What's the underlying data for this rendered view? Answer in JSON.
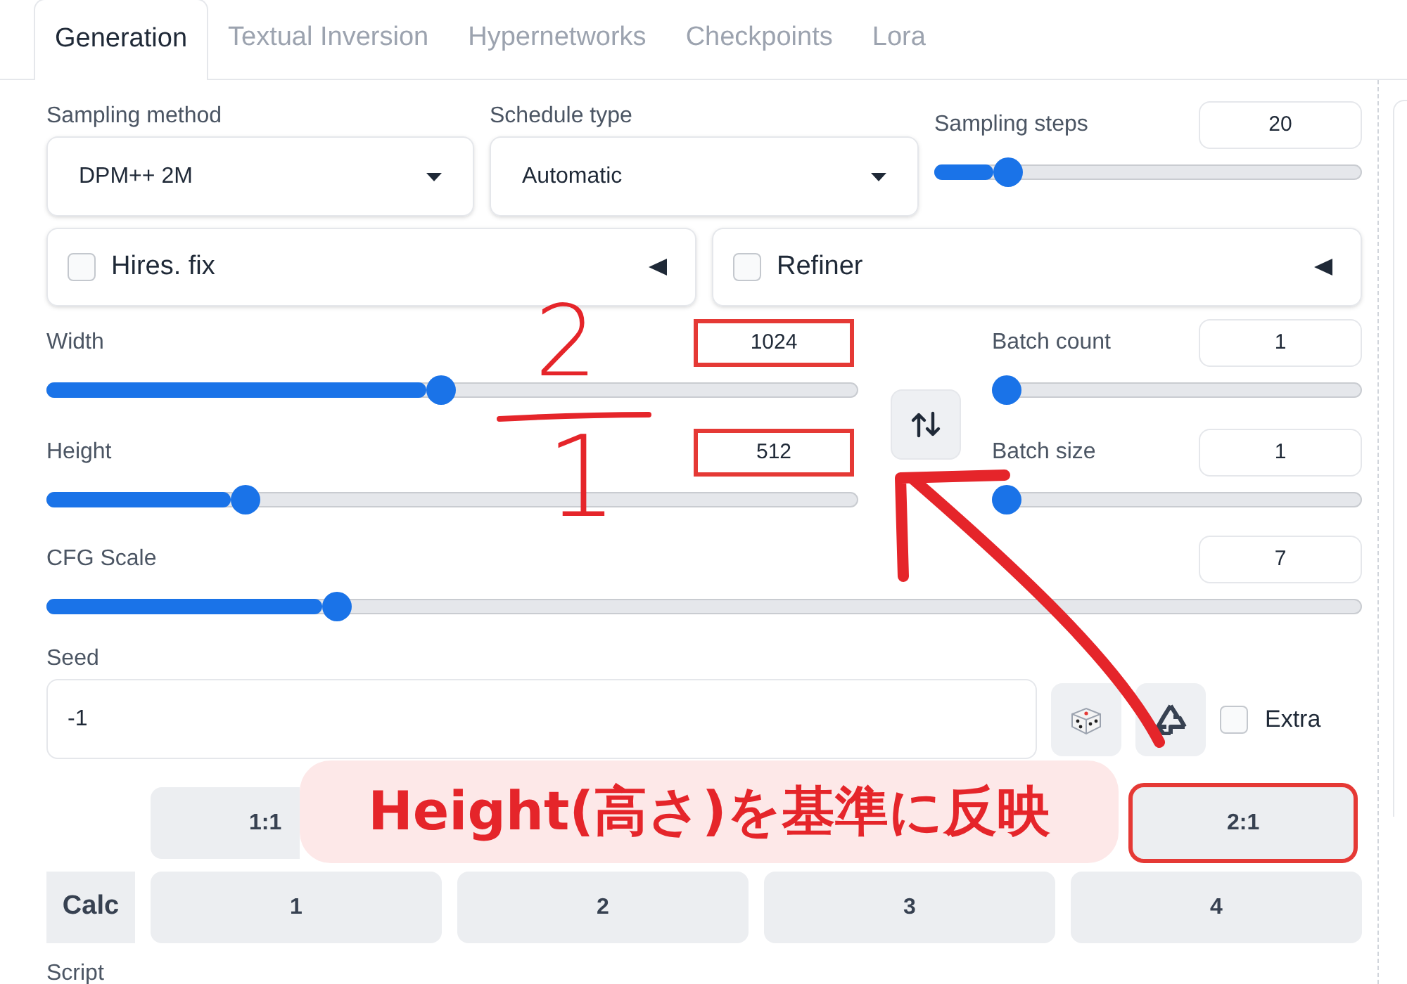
{
  "tabs": [
    {
      "label": "Generation",
      "selected": true
    },
    {
      "label": "Textual Inversion",
      "selected": false
    },
    {
      "label": "Hypernetworks",
      "selected": false
    },
    {
      "label": "Checkpoints",
      "selected": false
    },
    {
      "label": "Lora",
      "selected": false
    }
  ],
  "sampling_method": {
    "label": "Sampling method",
    "value": "DPM++ 2M"
  },
  "schedule_type": {
    "label": "Schedule type",
    "value": "Automatic"
  },
  "sampling_steps": {
    "label": "Sampling steps",
    "value": "20",
    "level": 0.15,
    "highlighted": false
  },
  "accordions": [
    {
      "label": "Hires. fix",
      "checked": false
    },
    {
      "label": "Refiner",
      "checked": false
    }
  ],
  "width": {
    "label": "Width",
    "value": "1024",
    "level": 0.485,
    "highlighted": true
  },
  "height": {
    "label": "Height",
    "value": "512",
    "level": 0.235,
    "highlighted": true
  },
  "batch_count": {
    "label": "Batch count",
    "value": "1",
    "level": 0,
    "highlighted": false
  },
  "batch_size": {
    "label": "Batch size",
    "value": "1",
    "level": 0,
    "highlighted": false
  },
  "cfg_scale": {
    "label": "CFG Scale",
    "value": "7",
    "level": 0.214,
    "highlighted": false
  },
  "seed": {
    "label": "Seed",
    "value": "-1"
  },
  "extra": {
    "label": "Extra",
    "checked": false
  },
  "ratio_buttons": [
    {
      "label": "1:1",
      "highlighted": false
    },
    {
      "label": "2:1",
      "highlighted": true
    }
  ],
  "calc": {
    "label": "Calc",
    "buttons": [
      "1",
      "2",
      "3",
      "4"
    ]
  },
  "script_label": "Script",
  "annotation": {
    "numerator": "2",
    "denominator": "1",
    "callout": "Height(高さ)を基準に反映"
  }
}
